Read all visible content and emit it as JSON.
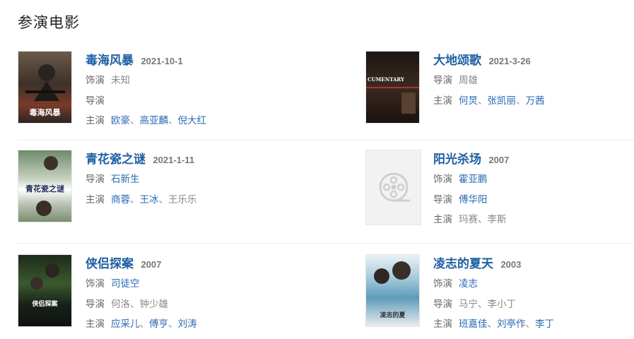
{
  "section": {
    "title": "参演电影"
  },
  "movies": [
    {
      "title": "毒海风暴",
      "date": "2021-10-1",
      "poster_text": "毒海风暴",
      "rows": [
        {
          "role": "饰演",
          "names": [
            {
              "text": "未知",
              "linked": false
            }
          ]
        },
        {
          "role": "导演",
          "names": []
        },
        {
          "role": "主演",
          "names": [
            {
              "text": "欧豪",
              "linked": true
            },
            {
              "text": "高亚麟",
              "linked": true
            },
            {
              "text": "倪大红",
              "linked": true
            }
          ]
        }
      ]
    },
    {
      "title": "大地颂歌",
      "date": "2021-3-26",
      "poster_text": "CUMENTARY",
      "rows": [
        {
          "role": "导演",
          "names": [
            {
              "text": "周雄",
              "linked": false
            }
          ]
        },
        {
          "role": "主演",
          "names": [
            {
              "text": "何炅",
              "linked": true
            },
            {
              "text": "张凯丽",
              "linked": true
            },
            {
              "text": "万茜",
              "linked": true
            }
          ]
        }
      ]
    },
    {
      "title": "青花瓷之谜",
      "date": "2021-1-11",
      "poster_text": "青花瓷之谜",
      "rows": [
        {
          "role": "导演",
          "names": [
            {
              "text": "石新生",
              "linked": true
            }
          ]
        },
        {
          "role": "主演",
          "names": [
            {
              "text": "商蓉",
              "linked": true
            },
            {
              "text": "王冰",
              "linked": true
            },
            {
              "text": "王乐乐",
              "linked": false
            }
          ]
        }
      ]
    },
    {
      "title": "阳光杀场",
      "date": "2007",
      "poster_text": "",
      "rows": [
        {
          "role": "饰演",
          "names": [
            {
              "text": "霍亚鹏",
              "linked": true
            }
          ]
        },
        {
          "role": "导演",
          "names": [
            {
              "text": "傅华阳",
              "linked": true
            }
          ]
        },
        {
          "role": "主演",
          "names": [
            {
              "text": "玛赛",
              "linked": false
            },
            {
              "text": "李斯",
              "linked": false
            }
          ]
        }
      ]
    },
    {
      "title": "侠侣探案",
      "date": "2007",
      "poster_text": "侠侣探案",
      "rows": [
        {
          "role": "饰演",
          "names": [
            {
              "text": "司徒空",
              "linked": true
            }
          ]
        },
        {
          "role": "导演",
          "names": [
            {
              "text": "何洛",
              "linked": false
            },
            {
              "text": "钟少雄",
              "linked": false
            }
          ]
        },
        {
          "role": "主演",
          "names": [
            {
              "text": "应采儿",
              "linked": true
            },
            {
              "text": "傅亨",
              "linked": true
            },
            {
              "text": "刘涛",
              "linked": true
            }
          ]
        }
      ]
    },
    {
      "title": "凌志的夏天",
      "date": "2003",
      "poster_text": "凌志的夏",
      "rows": [
        {
          "role": "饰演",
          "names": [
            {
              "text": "凌志",
              "linked": true
            }
          ]
        },
        {
          "role": "导演",
          "names": [
            {
              "text": "马宁",
              "linked": false
            },
            {
              "text": "李小丁",
              "linked": false
            }
          ]
        },
        {
          "role": "主演",
          "names": [
            {
              "text": "班嘉佳",
              "linked": true
            },
            {
              "text": "刘亭作",
              "linked": true
            },
            {
              "text": "李丁",
              "linked": true
            }
          ]
        }
      ]
    }
  ],
  "icons": {
    "placeholder": "film-reel-icon"
  },
  "colors": {
    "link": "#2a6ab3",
    "title": "#1e5fa3",
    "date": "#777777"
  }
}
